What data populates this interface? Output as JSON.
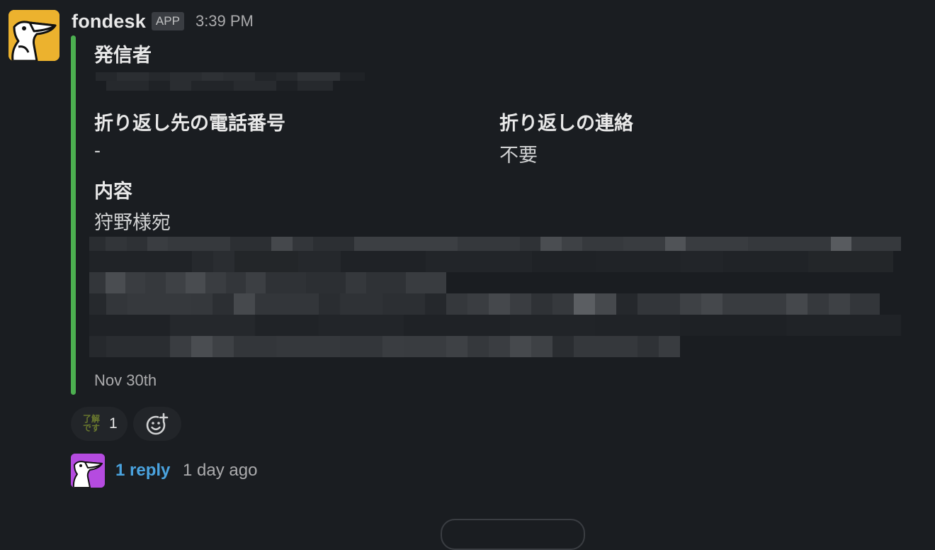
{
  "message": {
    "sender": "fondesk",
    "badge": "APP",
    "time": "3:39 PM",
    "accent_color": "#4caf50"
  },
  "fields": {
    "sender_label": "発信者",
    "phone_label": "折り返し先の電話番号",
    "phone_value": "-",
    "callback_label": "折り返しの連絡",
    "callback_value": "不要",
    "content_label": "内容",
    "content_value": "狩野様宛"
  },
  "date": "Nov 30th",
  "reactions": [
    {
      "emoji_text": "了解です",
      "count": "1"
    }
  ],
  "add_reaction_icon": "add-emoji-icon",
  "thread": {
    "reply_label": "1 reply",
    "last_reply": "1 day ago"
  }
}
